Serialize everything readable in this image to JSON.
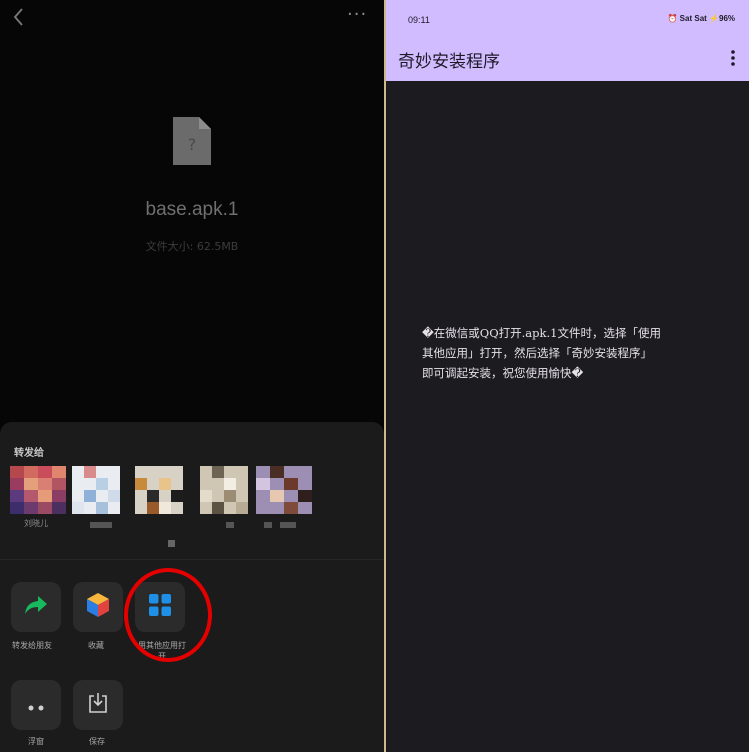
{
  "left": {
    "file": {
      "name": "base.apk.1",
      "size_text": "文件大小: 62.5MB"
    },
    "share_sheet": {
      "title": "转发给",
      "contacts": [
        {
          "name": "刘晓儿"
        },
        {
          "name": ""
        },
        {
          "name": ""
        },
        {
          "name": ""
        },
        {
          "name": ""
        }
      ],
      "actions": [
        {
          "label": "转发给朋友",
          "icon": "share-arrow-icon"
        },
        {
          "label": "收藏",
          "icon": "favorite-cube-icon"
        },
        {
          "label": "用其他应用打开",
          "icon": "apps-grid-icon"
        },
        {
          "label": "浮窗",
          "icon": "floating-window-icon"
        },
        {
          "label": "保存",
          "icon": "save-download-icon"
        }
      ]
    },
    "colors": {
      "highlight_ring": "#e50000",
      "share_green": "#19b95d"
    }
  },
  "right": {
    "status_bar": {
      "time": "09:11",
      "icons_text": "⏰ Sat Sat ⚡96%"
    },
    "app_bar": {
      "title": "奇妙安装程序"
    },
    "message_lines": [
      "�在微信或QQ打开.apk.1文件时，选择「使用",
      "其他应用」打开，然后选择「奇妙安装程序」",
      "即可调起安装，祝您使用愉快�"
    ],
    "colors": {
      "accent": "#d0bcff",
      "background": "#1c1b20"
    }
  }
}
